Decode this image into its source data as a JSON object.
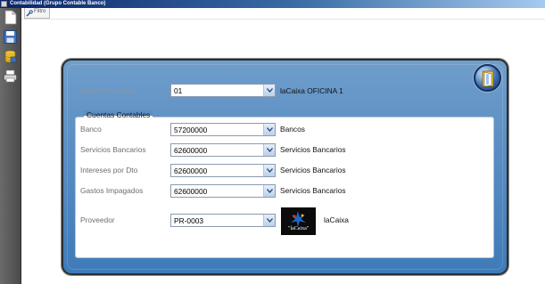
{
  "window": {
    "title": "Contabilidad (Grupo Contable Banco)"
  },
  "toolbar": {
    "items": [
      {
        "name": "new-document",
        "icon": "document-icon"
      },
      {
        "name": "save",
        "icon": "floppy-disk-icon"
      },
      {
        "name": "database",
        "icon": "database-icon"
      },
      {
        "name": "print",
        "icon": "printer-icon"
      }
    ]
  },
  "tab": {
    "label": "Filtro"
  },
  "form": {
    "banco_empresa": {
      "label": "Banco Empresa",
      "value": "01",
      "description": "laCaixa OFICINA 1"
    },
    "group_title": "Cuentas Contables",
    "rows": [
      {
        "label": "Banco",
        "value": "57200000",
        "description": "Bancos"
      },
      {
        "label": "Servicios Bancarios",
        "value": "62600000",
        "description": "Servicios Bancarios"
      },
      {
        "label": "Intereses por Dto",
        "value": "62600000",
        "description": "Servicios Bancarios"
      },
      {
        "label": "Gastos Impagados",
        "value": "62600000",
        "description": "Servicios Bancarios"
      }
    ],
    "proveedor": {
      "label": "Proveedor",
      "value": "PR-0003",
      "description": "laCaixa",
      "logo_text": "\"laCaixa\""
    }
  },
  "colors": {
    "panel": "#5b8ec3",
    "titlebar": "#0a246a",
    "logo_star_blue": "#1e66c8"
  }
}
